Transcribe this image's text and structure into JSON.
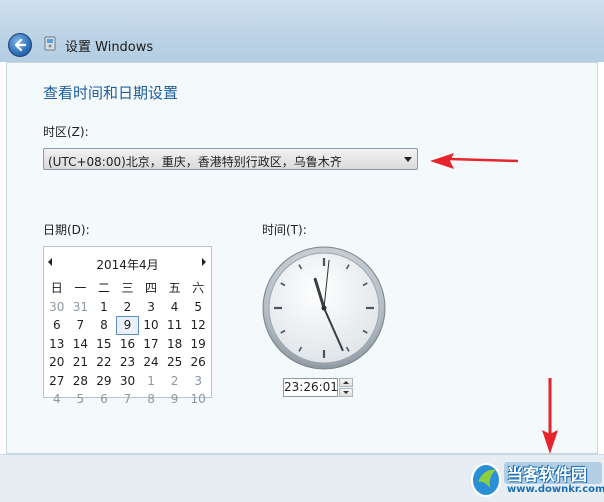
{
  "window": {
    "title": "设置 Windows"
  },
  "page": {
    "heading": "查看时间和日期设置"
  },
  "timezone": {
    "label": "时区(Z):",
    "selected": "(UTC+08:00)北京，重庆，香港特别行政区，乌鲁木齐"
  },
  "date": {
    "label": "日期(D):",
    "month_label": "2014年4月",
    "weekdays": [
      "日",
      "一",
      "二",
      "三",
      "四",
      "五",
      "六"
    ],
    "selected_day": "9",
    "weeks": [
      [
        {
          "d": "30",
          "muted": true
        },
        {
          "d": "31",
          "muted": true
        },
        {
          "d": "1"
        },
        {
          "d": "2"
        },
        {
          "d": "3"
        },
        {
          "d": "4"
        },
        {
          "d": "5"
        }
      ],
      [
        {
          "d": "6"
        },
        {
          "d": "7"
        },
        {
          "d": "8"
        },
        {
          "d": "9",
          "selected": true
        },
        {
          "d": "10"
        },
        {
          "d": "11"
        },
        {
          "d": "12"
        }
      ],
      [
        {
          "d": "13"
        },
        {
          "d": "14"
        },
        {
          "d": "15"
        },
        {
          "d": "16"
        },
        {
          "d": "17"
        },
        {
          "d": "18"
        },
        {
          "d": "19"
        }
      ],
      [
        {
          "d": "20"
        },
        {
          "d": "21"
        },
        {
          "d": "22"
        },
        {
          "d": "23"
        },
        {
          "d": "24"
        },
        {
          "d": "25"
        },
        {
          "d": "26"
        }
      ],
      [
        {
          "d": "27"
        },
        {
          "d": "28"
        },
        {
          "d": "29"
        },
        {
          "d": "30"
        },
        {
          "d": "1",
          "muted": true
        },
        {
          "d": "2",
          "muted": true
        },
        {
          "d": "3",
          "muted": true
        }
      ],
      [
        {
          "d": "4",
          "muted": true
        },
        {
          "d": "5",
          "muted": true
        },
        {
          "d": "6",
          "muted": true
        },
        {
          "d": "7",
          "muted": true
        },
        {
          "d": "8",
          "muted": true
        },
        {
          "d": "9",
          "muted": true
        },
        {
          "d": "10",
          "muted": true
        }
      ]
    ]
  },
  "time": {
    "label": "时间(T):",
    "value": "23:26:01",
    "hours": 23,
    "minutes": 26,
    "seconds": 1
  },
  "watermark": {
    "text": "当客软件园",
    "url": "www.downkr.com"
  },
  "colors": {
    "heading": "#1f5fa0",
    "annotation_arrow": "#e8242c",
    "watermark": "#1b6fb4"
  },
  "icons": {
    "back": "back-arrow-icon",
    "setup": "setup-windows-icon",
    "dropdown": "chevron-down-icon"
  }
}
